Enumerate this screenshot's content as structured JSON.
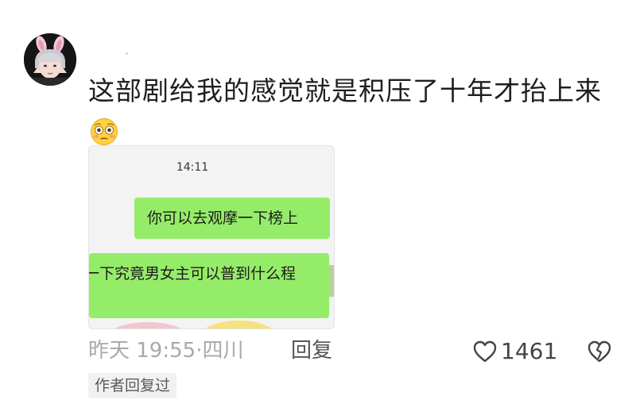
{
  "comment": {
    "avatar_icon": "user-avatar-bunny-ears",
    "text": "这部剧给我的感觉就是积压了十年才抬上来",
    "emoji_icon": "flushed-face-emoji",
    "attached_image": {
      "time": "14:11",
      "bubble_1": "你可以去观摩一下榜上",
      "bubble_2": "一下究竟男女主可以普到什么程",
      "bubble_color": "#95ec69"
    },
    "meta": {
      "time_location": "昨天 19:55·四川",
      "reply_label": "回复"
    },
    "likes": {
      "icon": "heart-outline-icon",
      "count": "1461"
    },
    "dislike_icon": "broken-heart-icon",
    "author_badge": "作者回复过"
  }
}
